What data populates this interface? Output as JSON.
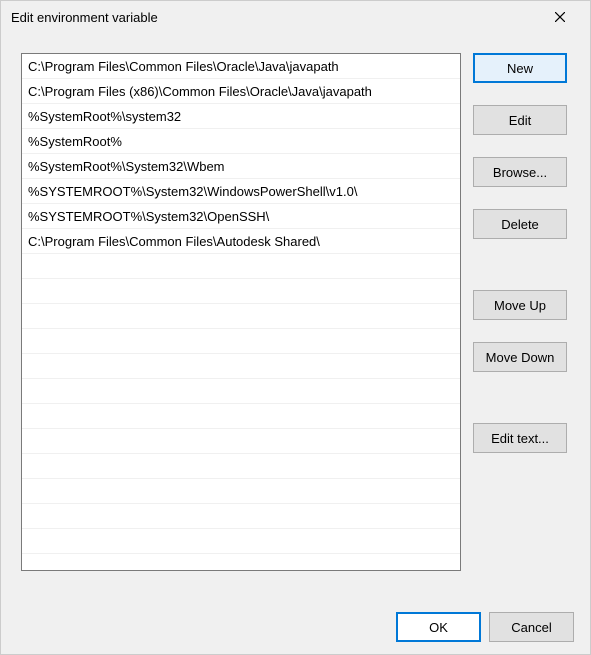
{
  "title": "Edit environment variable",
  "paths": [
    "C:\\Program Files\\Common Files\\Oracle\\Java\\javapath",
    "C:\\Program Files (x86)\\Common Files\\Oracle\\Java\\javapath",
    "%SystemRoot%\\system32",
    "%SystemRoot%",
    "%SystemRoot%\\System32\\Wbem",
    "%SYSTEMROOT%\\System32\\WindowsPowerShell\\v1.0\\",
    "%SYSTEMROOT%\\System32\\OpenSSH\\",
    "C:\\Program Files\\Common Files\\Autodesk Shared\\"
  ],
  "buttons": {
    "new": "New",
    "edit": "Edit",
    "browse": "Browse...",
    "delete": "Delete",
    "moveUp": "Move Up",
    "moveDown": "Move Down",
    "editText": "Edit text...",
    "ok": "OK",
    "cancel": "Cancel"
  }
}
